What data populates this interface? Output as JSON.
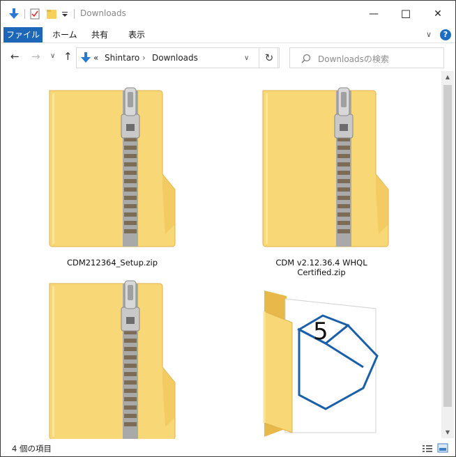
{
  "window": {
    "title": "Downloads",
    "minimize_glyph": "—",
    "maximize_glyph": "☐",
    "close_glyph": "✕"
  },
  "ribbon": {
    "tabs": [
      "ファイル",
      "ホーム",
      "共有",
      "表示"
    ],
    "expand_glyph": "∨",
    "help_glyph": "?"
  },
  "nav": {
    "back_glyph": "←",
    "forward_glyph": "→",
    "recent_glyph": "∨",
    "up_glyph": "↑",
    "overflow_glyph": "«",
    "breadcrumb": [
      "Shintaro",
      "Downloads"
    ],
    "separator": "›",
    "dropdown_glyph": "∨",
    "refresh_glyph": "↻",
    "search_placeholder": "Downloadsの検索"
  },
  "files": [
    {
      "name": "CDM212364_Setup.zip",
      "type": "zip"
    },
    {
      "name": "CDM v2.12.36.4 WHQL Certified.zip",
      "type": "zip"
    },
    {
      "name": "",
      "type": "zip"
    },
    {
      "name": "",
      "type": "folder"
    }
  ],
  "status": {
    "item_count": "4 個の項目"
  },
  "colors": {
    "accent": "#1d66b8",
    "folder": "#f8d876",
    "folder_dark": "#e8b84a"
  }
}
